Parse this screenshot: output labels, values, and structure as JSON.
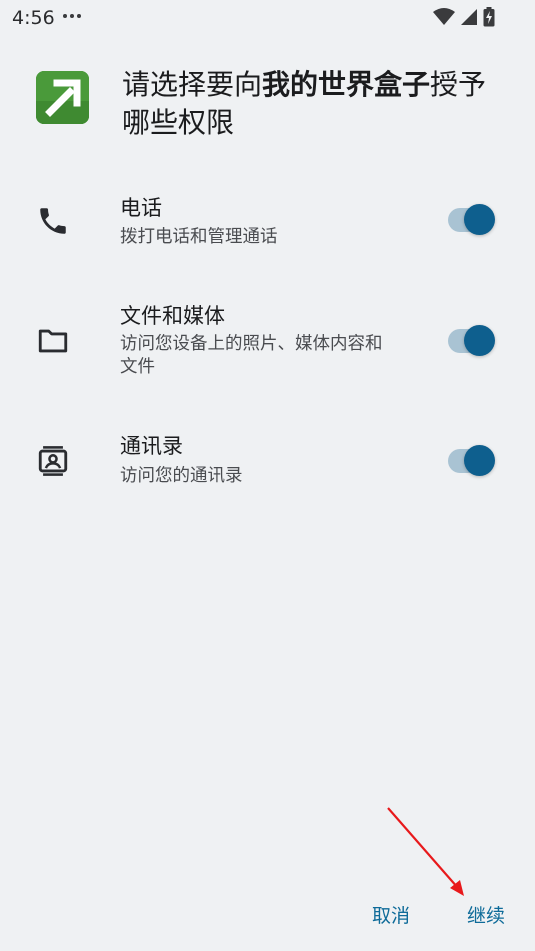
{
  "status_bar": {
    "time": "4:56",
    "icons": [
      "more-dots-icon",
      "wifi-icon",
      "cell-signal-icon",
      "battery-charging-icon"
    ]
  },
  "dialog": {
    "title_prefix": "请选择要向",
    "app_name": "我的世界盒子",
    "title_suffix": "授予哪些权限",
    "app_icon": "pickaxe-app-icon",
    "permissions": [
      {
        "title": "电话",
        "description": "拨打电话和管理通话",
        "icon": "phone-icon",
        "enabled": true
      },
      {
        "title": "文件和媒体",
        "description": "访问您设备上的照片、媒体内容和文件",
        "icon": "folder-icon",
        "enabled": true
      },
      {
        "title": "通讯录",
        "description": "访问您的通讯录",
        "icon": "contacts-icon",
        "enabled": true
      }
    ],
    "cancel_label": "取消",
    "continue_label": "继续"
  },
  "colors": {
    "background": "#eff1f3",
    "accent": "#0e5f8e",
    "toggle_track": "#a9c3d3",
    "button_text": "#0e6b99",
    "annotation_arrow": "#e8191b"
  }
}
